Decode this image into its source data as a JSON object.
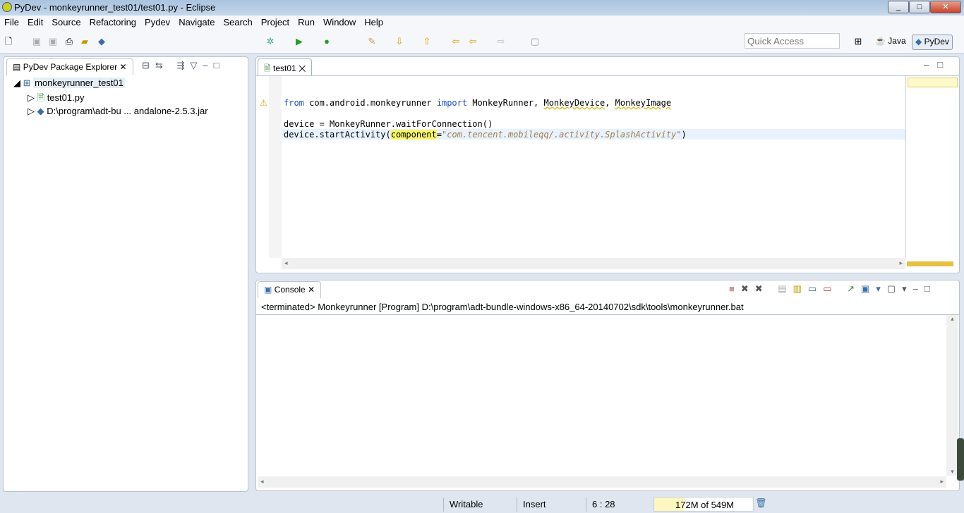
{
  "window": {
    "title": "PyDev - monkeyrunner_test01/test01.py - Eclipse"
  },
  "menu": [
    "File",
    "Edit",
    "Source",
    "Refactoring",
    "Pydev",
    "Navigate",
    "Search",
    "Project",
    "Run",
    "Window",
    "Help"
  ],
  "toolbar": {
    "quick_access_placeholder": "Quick Access",
    "perspectives": [
      "Java",
      "PyDev"
    ]
  },
  "explorer": {
    "tab": "PyDev Package Explorer",
    "project": "monkeyrunner_test01",
    "items": [
      "test01.py",
      "D:\\program\\adt-bu ... andalone-2.5.3.jar"
    ]
  },
  "editor": {
    "tab": "test01",
    "line1": {
      "kw1": "from",
      "mod": " com.android.monkeyrunner ",
      "kw2": "import",
      "names1": " MonkeyRunner, ",
      "n2": "MonkeyDevice",
      ", ": ", ",
      "n3": "MonkeyImage"
    },
    "line2": "device = MonkeyRunner.waitForConnection()",
    "line3": {
      "pre": "device.startActivity(",
      "param": "component",
      "eq": "=",
      "str": "\"com.tencent.mobileqq/.activity.SplashActivity\"",
      "post": ")"
    }
  },
  "console": {
    "tab": "Console",
    "status": "<terminated> Monkeyrunner [Program] D:\\program\\adt-bundle-windows-x86_64-20140702\\sdk\\tools\\monkeyrunner.bat"
  },
  "statusbar": {
    "writable": "Writable",
    "insert": "Insert",
    "position": "6 : 28",
    "heap": "172M of 549M",
    "heap_used_fraction": 0.31
  }
}
